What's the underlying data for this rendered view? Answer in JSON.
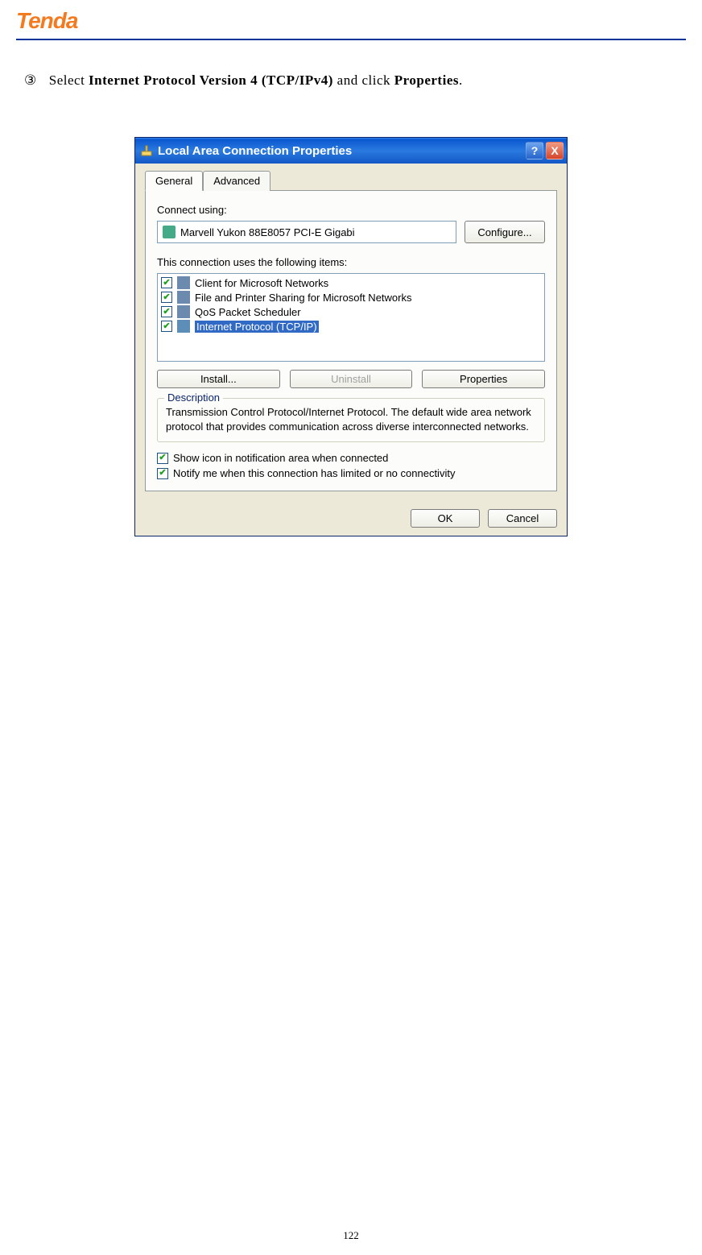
{
  "header": {
    "logo": "Tenda"
  },
  "instruction": {
    "number": "③",
    "prefix": "Select ",
    "bold1": "Internet Protocol Version 4 (TCP/IPv4)",
    "middle": " and click ",
    "bold2": "Properties",
    "suffix": "."
  },
  "dialog": {
    "title": "Local Area Connection Properties",
    "help_symbol": "?",
    "close_symbol": "X",
    "tabs": {
      "general": "General",
      "advanced": "Advanced"
    },
    "connect_using_label": "Connect using:",
    "adapter": "Marvell Yukon 88E8057 PCI-E Gigabi",
    "configure_btn": "Configure...",
    "items_label": "This connection uses the following items:",
    "items": [
      {
        "checked": true,
        "label": "Client for Microsoft Networks"
      },
      {
        "checked": true,
        "label": "File and Printer Sharing for Microsoft Networks"
      },
      {
        "checked": true,
        "label": "QoS Packet Scheduler"
      },
      {
        "checked": true,
        "label": "Internet Protocol (TCP/IP)",
        "selected": true
      }
    ],
    "install_btn": "Install...",
    "uninstall_btn": "Uninstall",
    "properties_btn": "Properties",
    "description_legend": "Description",
    "description_text": "Transmission Control Protocol/Internet Protocol. The default wide area network protocol that provides communication across diverse interconnected networks.",
    "opt_show_icon": "Show icon in notification area when connected",
    "opt_notify": "Notify me when this connection has limited or no connectivity",
    "ok_btn": "OK",
    "cancel_btn": "Cancel"
  },
  "page_number": "122"
}
